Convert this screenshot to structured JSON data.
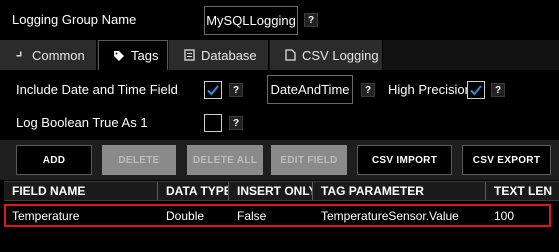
{
  "header": {
    "group_name_label": "Logging Group Name",
    "group_name_value": "MySQLLogging",
    "help": "?"
  },
  "tabs": [
    {
      "label": "Common",
      "icon": "chevron-icon",
      "active": false
    },
    {
      "label": "Tags",
      "icon": "tag-icon",
      "active": true
    },
    {
      "label": "Database",
      "icon": "database-icon",
      "active": false
    },
    {
      "label": "CSV Logging",
      "icon": "csv-icon",
      "active": false
    }
  ],
  "options": {
    "include_date_time_label": "Include Date and Time Field",
    "include_date_time_checked": true,
    "date_time_field_value": "DateAndTime",
    "high_precision_label": "High Precision",
    "high_precision_checked": true,
    "log_boolean_label": "Log Boolean True As 1",
    "log_boolean_checked": false
  },
  "toolbar": {
    "add": "ADD",
    "delete": "DELETE",
    "delete_all": "DELETE ALL",
    "edit_field": "EDIT FIELD",
    "csv_import": "CSV IMPORT",
    "csv_export": "CSV EXPORT"
  },
  "table": {
    "columns": [
      "FIELD NAME",
      "DATA TYPE",
      "INSERT ONLY",
      "TAG PARAMETER",
      "TEXT LEN"
    ],
    "rows": [
      [
        "Temperature",
        "Double",
        "False",
        "TemperatureSensor.Value",
        "100"
      ]
    ]
  },
  "colors": {
    "background": "#000000",
    "highlight_border": "#e01515",
    "check_accent": "#2a8fd6",
    "disabled_button": "#8a8a8a"
  }
}
